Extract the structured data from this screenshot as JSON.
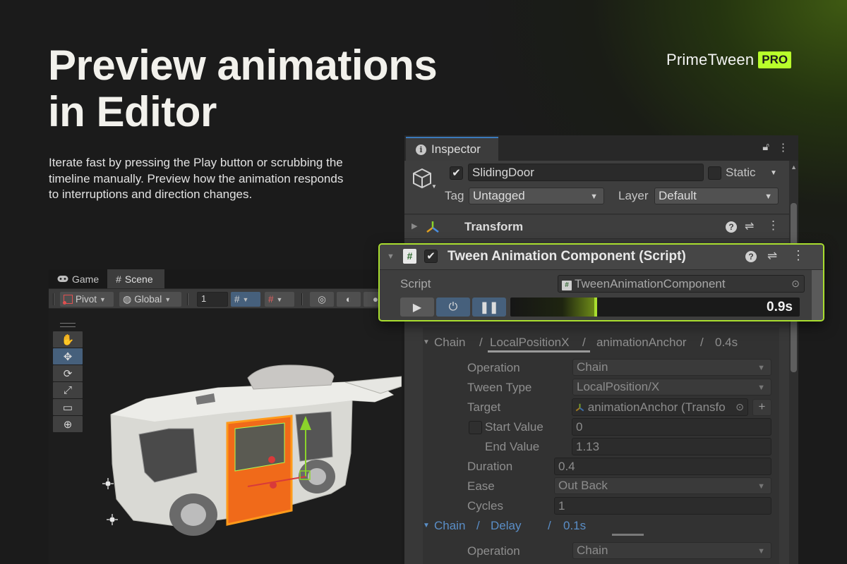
{
  "headline": [
    "Preview animations",
    "in Editor"
  ],
  "description": "Iterate fast by pressing the Play button or scrubbing the timeline manually. Preview how the animation responds to interruptions and direction changes.",
  "brand": {
    "name": "PrimeTween",
    "badge": "PRO",
    "badge_color": "#b8ff2b"
  },
  "scene": {
    "tabs": [
      {
        "label": "Game",
        "icon": "gamepad-icon"
      },
      {
        "label": "Scene",
        "icon": "grid-hash-icon"
      }
    ],
    "toolbar": {
      "pivot": "Pivot",
      "global": "Global",
      "grid_value": "1"
    },
    "tools": [
      "hand-tool-icon",
      "move-tool-icon",
      "rotate-tool-icon",
      "scale-tool-icon",
      "rect-tool-icon",
      "transform-tool-icon"
    ]
  },
  "inspector": {
    "tab_label": "Inspector",
    "object_name": "SlidingDoor",
    "static_label": "Static",
    "tag_label": "Tag",
    "tag_value": "Untagged",
    "layer_label": "Layer",
    "layer_value": "Default",
    "transform_label": "Transform",
    "accent": "#3a79bb"
  },
  "component": {
    "title": "Tween Animation Component (Script)",
    "script_label": "Script",
    "script_value": "TweenAnimationComponent",
    "time": "0.9s",
    "progress": 0.3,
    "highlight_color": "#a9de2f"
  },
  "chain1": {
    "parts": [
      "Chain",
      "/",
      "LocalPositionX",
      "/",
      "animationAnchor",
      "/",
      "0.4s"
    ],
    "rows": [
      {
        "label": "Operation",
        "value": "Chain",
        "dropdown": true
      },
      {
        "label": "Tween Type",
        "value": "LocalPosition/X",
        "dropdown": true
      },
      {
        "label": "Target",
        "value": "animationAnchor (Transfo"
      },
      {
        "label": "Start Value",
        "value": "0"
      },
      {
        "label": "End Value",
        "value": "1.13"
      },
      {
        "label": "Duration",
        "value": "0.4"
      },
      {
        "label": "Ease",
        "value": "Out Back",
        "dropdown": true
      },
      {
        "label": "Cycles",
        "value": "1"
      }
    ]
  },
  "chain2": {
    "parts": [
      "Chain",
      "/",
      "Delay",
      "/",
      "0.1s"
    ],
    "rows": [
      {
        "label": "Operation",
        "value": "Chain",
        "dropdown": true
      }
    ]
  }
}
